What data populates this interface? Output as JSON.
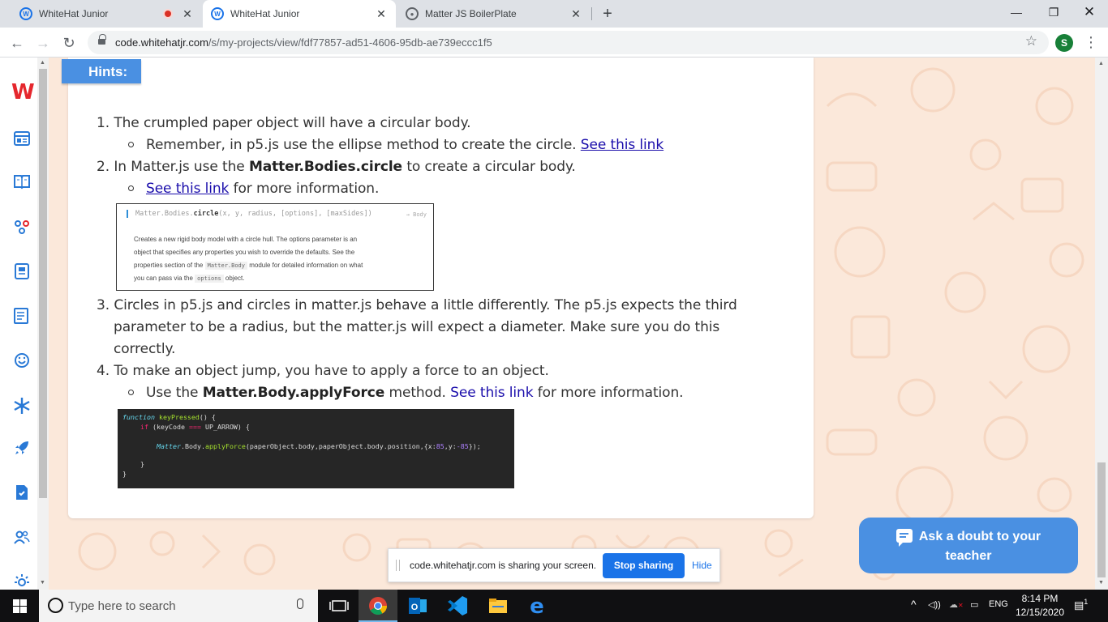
{
  "browser": {
    "tabs": [
      {
        "label": "WhiteHat Junior",
        "recording": true
      },
      {
        "label": "WhiteHat Junior",
        "active": true
      },
      {
        "label": "Matter JS BoilerPlate"
      }
    ],
    "new_tab_label": "+",
    "url_host": "code.whitehatjr.com",
    "url_path": "/s/my-projects/view/fdf77857-ad51-4606-95db-ae739eccc1f5",
    "profile_initial": "S"
  },
  "hints": {
    "badge": "Hints:",
    "item1_num": "1.",
    "item1": "The crumpled paper object will have a circular body.",
    "item1_sub_text": "Remember, in p5.js use the ellipse method to create the circle.",
    "item1_sub_link": "See this link",
    "item2_num": "2.",
    "item2_pre": "In Matter.js use the",
    "item2_bold": "Matter.Bodies.circle",
    "item2_post": "to create a circular body.",
    "item2_sub_link": "See this link",
    "item2_sub_text": "for more information.",
    "item3_num": "3.",
    "item3_line1": "Circles in p5.js and circles in matter.js behave a little differently. The p5.js expects the third",
    "item3_line2": "parameter to be a radius, but the matter.js will expect a diameter. Make sure you do this",
    "item3_line3": "correctly.",
    "item4_num": "4.",
    "item4": "To make an object jump, you have to apply a force to an object.",
    "item4_sub_pre": "Use the",
    "item4_sub_bold": "Matter.Body.applyForce",
    "item4_sub_mid": "method.",
    "item4_sub_link": "See this link",
    "item4_sub_post": "for more information."
  },
  "doc_snippet": {
    "sig_prefix": "Matter.Bodies.",
    "sig_fn": "circle",
    "sig_args": "(x, y, radius, [options], [maxSides])",
    "returns": "→ Body",
    "desc1": "Creates a new rigid body model with a circle hull. The options parameter is an",
    "desc2": "object that specifies any properties you wish to override the defaults. See the",
    "desc3_pre": "properties section of the",
    "desc3_code": "Matter.Body",
    "desc3_post": "module for detailed information on what",
    "desc4_pre": "you can pass via the",
    "desc4_code": "options",
    "desc4_post": "object."
  },
  "code_snippet": {
    "l1_kw": "function",
    "l1_fn": "keyPressed",
    "l1_rest": "() {",
    "l2_kw": "if",
    "l2_a": "(keyCode",
    "l2_op": "===",
    "l2_b": "UP_ARROW) {",
    "l3_cls": "Matter",
    "l3_a": ".Body.",
    "l3_fn": "applyForce",
    "l3_b": "(paperObject.body,paperObject.body.position,{x:",
    "l3_n1": "85",
    "l3_c": ",y:",
    "l3_n2": "-85",
    "l3_d": "});",
    "l4": "}",
    "l5": "}"
  },
  "ask_doubt": {
    "line1": "Ask a doubt to your",
    "line2": "teacher"
  },
  "sharebar": {
    "message": "code.whitehatjr.com is sharing your screen.",
    "stop_label": "Stop sharing",
    "hide_label": "Hide"
  },
  "taskbar": {
    "search_placeholder": "Type here to search",
    "lang": "ENG",
    "time": "8:14 PM",
    "date": "12/15/2020",
    "notif_count": "1"
  },
  "colors": {
    "accent": "#4a90e2",
    "link": "#1a0dab",
    "pattern_bg": "#fbe8da",
    "code_bg": "#262626"
  }
}
